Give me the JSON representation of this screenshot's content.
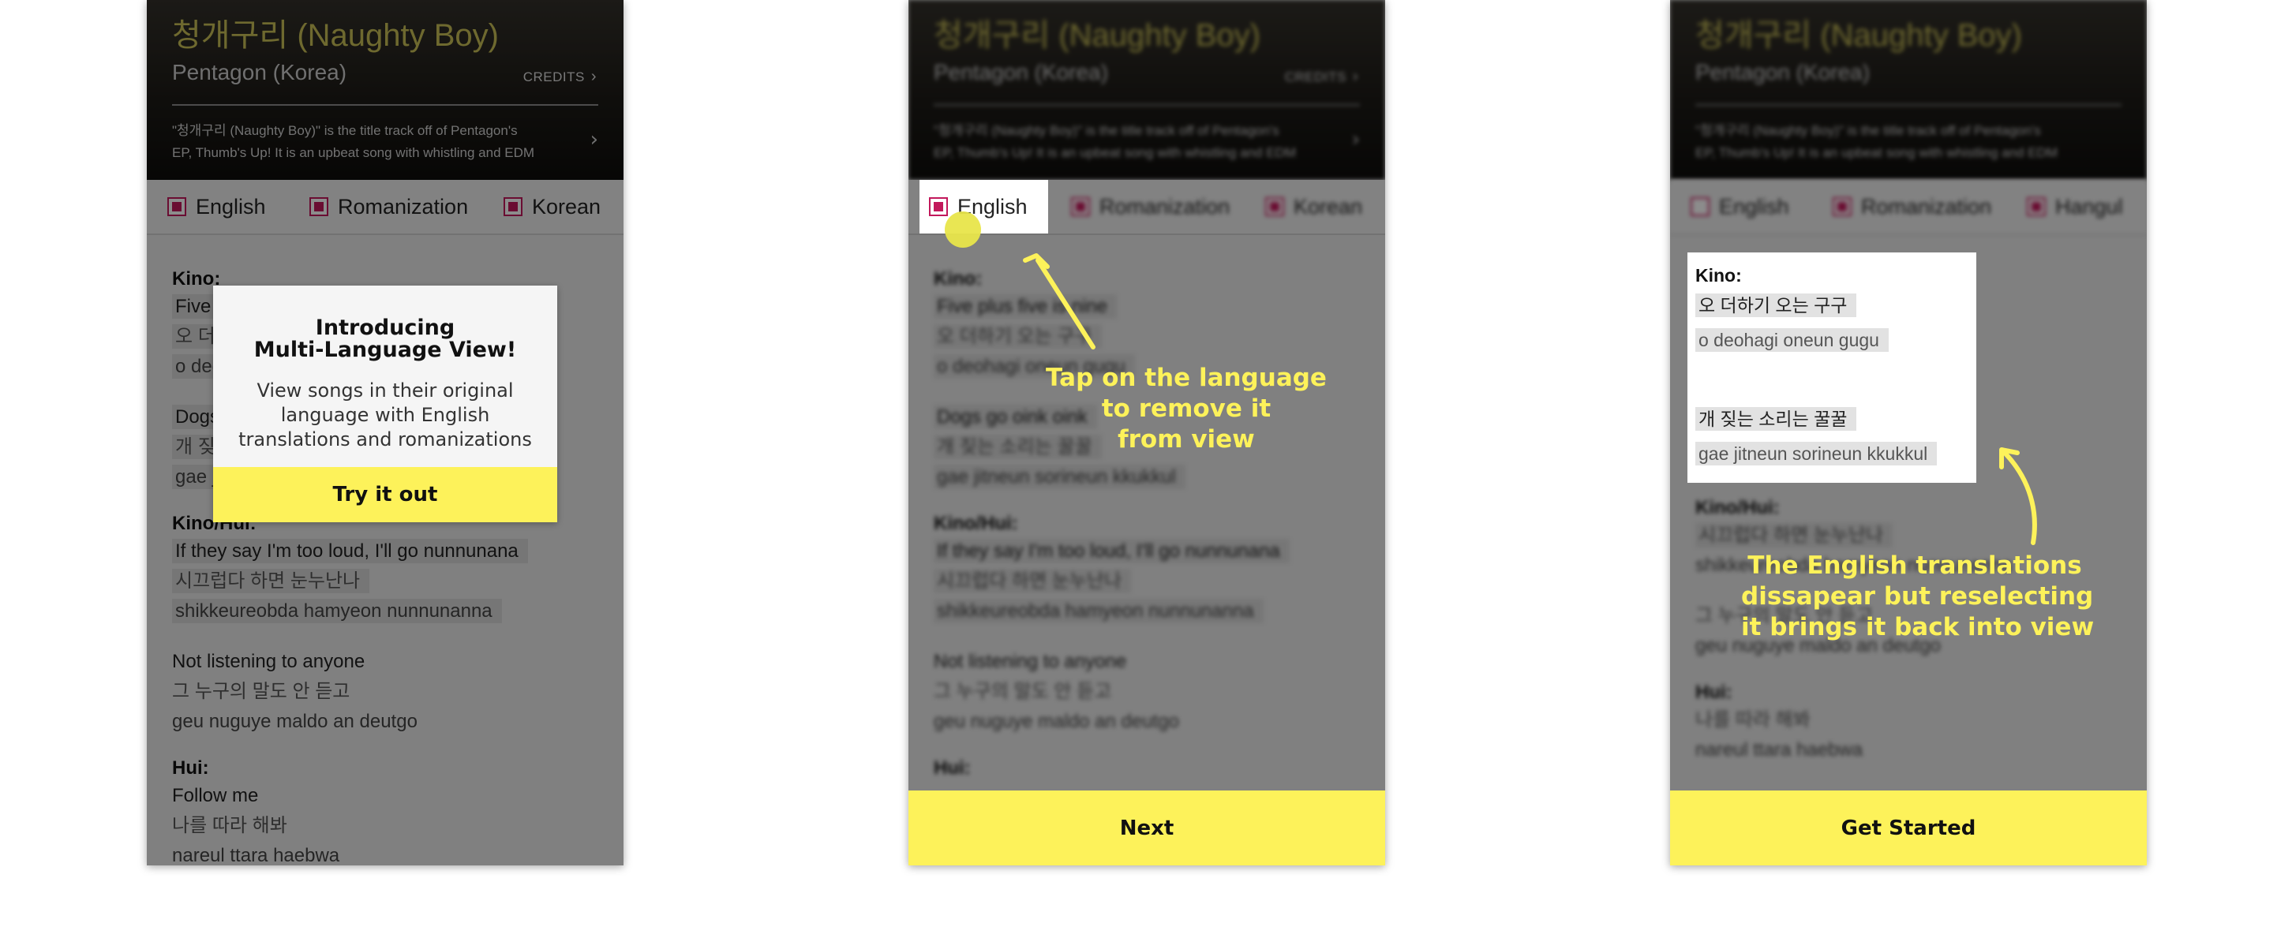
{
  "song": {
    "title": "청개구리 (Naughty Boy)",
    "artist": "Pentagon (Korea)",
    "credits_label": "CREDITS",
    "description_lines": [
      "\"청개구리 (Naughty Boy)\" is the title track off of Pentagon's",
      "EP, Thumb's Up! It is an upbeat song with whistling and EDM"
    ]
  },
  "languages": {
    "english": "English",
    "romanization": "Romanization",
    "korean": "Korean",
    "hangul": "Hangul"
  },
  "lyrics": [
    {
      "singer": "Kino:",
      "lines": [
        {
          "en": "Five plus five is nine",
          "kr": "오 더하기 오는 구구",
          "rm": "o deohagi oneun gugu"
        }
      ]
    },
    {
      "singer": "",
      "lines": [
        {
          "en": "Dogs go oink oink",
          "kr": "개 짖는 소리는 꿀꿀",
          "rm": "gae jitneun sorineun kkukkul"
        }
      ]
    },
    {
      "singer": "Kino/Hui:",
      "lines": [
        {
          "en": "If they say I'm too loud, I'll go nunnunana",
          "kr": "시끄럽다 하면 눈누난나",
          "rm": "shikkeureobda hamyeon nunnunanna"
        }
      ]
    },
    {
      "singer": "",
      "lines": [
        {
          "en": "Not listening to anyone",
          "kr": "그 누구의 말도 안 듣고",
          "rm": "geu nuguye maldo an deutgo"
        }
      ]
    },
    {
      "singer": "Hui:",
      "lines": [
        {
          "en": "Follow me",
          "kr": "나를 따라 해봐",
          "rm": "nareul ttara haebwa"
        }
      ]
    }
  ],
  "modal": {
    "title_line1": "Introducing",
    "title_line2": "Multi-Language View!",
    "body_line1": "View songs in their original",
    "body_line2": "language with English",
    "body_line3": "translations and romanizations",
    "button": "Try it out"
  },
  "step2": {
    "annotation_line1": "Tap on the language",
    "annotation_line2": "to remove it",
    "annotation_line3": "from view",
    "button": "Next"
  },
  "step3": {
    "annotation_line1": "The English translations",
    "annotation_line2": "dissapear but reselecting",
    "annotation_line3": "it brings it back into view",
    "button": "Get Started",
    "blurred_extra_1": "그 누구의 말도 안 듣고",
    "blurred_extra_2": "geu nuguye maldo an deutgo",
    "blurred_hui": "Hui:",
    "blurred_hui_kr": "나를 따라 해봐",
    "blurred_hui_rm": "nareul ttara haebwa"
  },
  "colors": {
    "accent_yellow": "#fdf25a",
    "checkbox": "#c2185b",
    "title_gold": "#c9bf57"
  }
}
